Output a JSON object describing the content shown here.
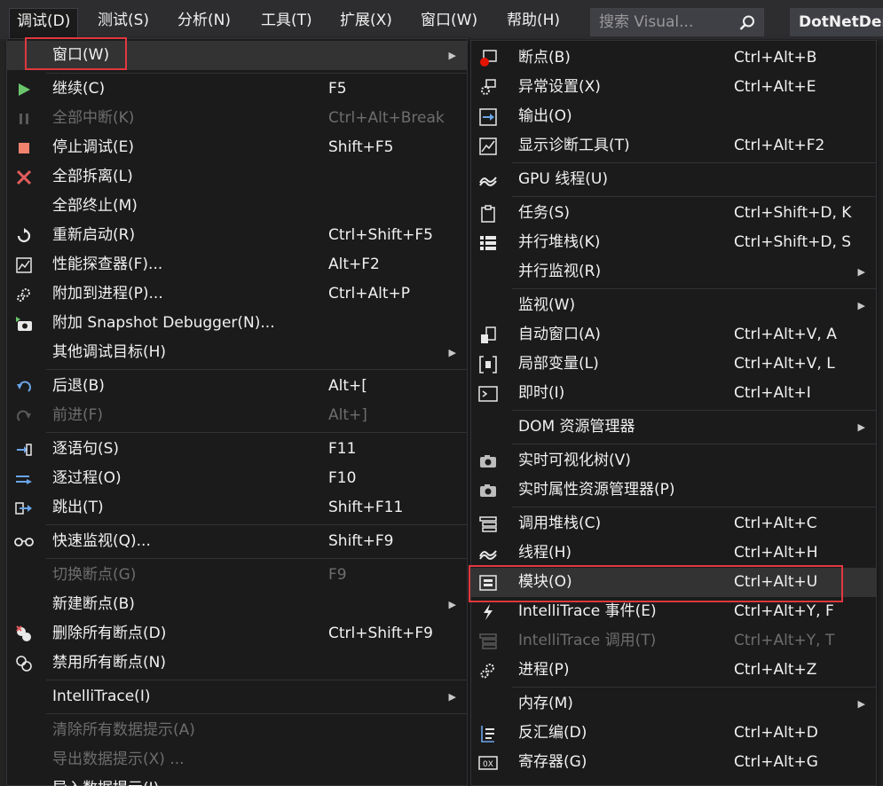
{
  "menubar": {
    "items": [
      {
        "label": "调试(D)"
      },
      {
        "label": "测试(S)"
      },
      {
        "label": "分析(N)"
      },
      {
        "label": "工具(T)"
      },
      {
        "label": "扩展(X)"
      },
      {
        "label": "窗口(W)"
      },
      {
        "label": "帮助(H)"
      }
    ],
    "search_placeholder": "搜索 Visual...",
    "solution_name": "DotNetDem"
  },
  "debug_menu": {
    "items": [
      {
        "label": "窗口(W)",
        "shortcut": "",
        "icon": "none"
      },
      {
        "label": "继续(C)",
        "shortcut": "F5",
        "icon": "play-icon"
      },
      {
        "label": "全部中断(K)",
        "shortcut": "Ctrl+Alt+Break",
        "icon": "pause-icon"
      },
      {
        "label": "停止调试(E)",
        "shortcut": "Shift+F5",
        "icon": "stop-icon"
      },
      {
        "label": "全部拆离(L)",
        "shortcut": "",
        "icon": "close-icon"
      },
      {
        "label": "全部终止(M)",
        "shortcut": "",
        "icon": "none"
      },
      {
        "label": "重新启动(R)",
        "shortcut": "Ctrl+Shift+F5",
        "icon": "restart-icon"
      },
      {
        "label": "性能探查器(F)...",
        "shortcut": "Alt+F2",
        "icon": "profiler-icon"
      },
      {
        "label": "附加到进程(P)...",
        "shortcut": "Ctrl+Alt+P",
        "icon": "gears-icon"
      },
      {
        "label": "附加 Snapshot Debugger(N)...",
        "shortcut": "",
        "icon": "camera-icon"
      },
      {
        "label": "其他调试目标(H)",
        "shortcut": "",
        "icon": "none"
      },
      {
        "label": "后退(B)",
        "shortcut": "Alt+[",
        "icon": "undo-icon"
      },
      {
        "label": "前进(F)",
        "shortcut": "Alt+]",
        "icon": "redo-icon"
      },
      {
        "label": "逐语句(S)",
        "shortcut": "F11",
        "icon": "step-into-icon"
      },
      {
        "label": "逐过程(O)",
        "shortcut": "F10",
        "icon": "step-over-icon"
      },
      {
        "label": "跳出(T)",
        "shortcut": "Shift+F11",
        "icon": "step-out-icon"
      },
      {
        "label": "快速监视(Q)...",
        "shortcut": "Shift+F9",
        "icon": "glasses-icon"
      },
      {
        "label": "切换断点(G)",
        "shortcut": "F9",
        "icon": "none"
      },
      {
        "label": "新建断点(B)",
        "shortcut": "",
        "icon": "none"
      },
      {
        "label": "删除所有断点(D)",
        "shortcut": "Ctrl+Shift+F9",
        "icon": "delete-breakpoints-icon"
      },
      {
        "label": "禁用所有断点(N)",
        "shortcut": "",
        "icon": "disable-breakpoints-icon"
      },
      {
        "label": "IntelliTrace(I)",
        "shortcut": "",
        "icon": "none"
      },
      {
        "label": "清除所有数据提示(A)",
        "shortcut": "",
        "icon": "none"
      },
      {
        "label": "导出数据提示(X) ...",
        "shortcut": "",
        "icon": "none"
      },
      {
        "label": "导入数据提示(I)...",
        "shortcut": "",
        "icon": "none"
      }
    ]
  },
  "window_submenu": {
    "items": [
      {
        "label": "断点(B)",
        "shortcut": "Ctrl+Alt+B",
        "icon": "breakpoint-window-icon"
      },
      {
        "label": "异常设置(X)",
        "shortcut": "Ctrl+Alt+E",
        "icon": "exception-settings-icon"
      },
      {
        "label": "输出(O)",
        "shortcut": "",
        "icon": "output-icon"
      },
      {
        "label": "显示诊断工具(T)",
        "shortcut": "Ctrl+Alt+F2",
        "icon": "diagnostics-icon"
      },
      {
        "label": "GPU 线程(U)",
        "shortcut": "",
        "icon": "gpu-threads-icon"
      },
      {
        "label": "任务(S)",
        "shortcut": "Ctrl+Shift+D, K",
        "icon": "tasks-icon"
      },
      {
        "label": "并行堆栈(K)",
        "shortcut": "Ctrl+Shift+D, S",
        "icon": "parallel-stacks-icon"
      },
      {
        "label": "并行监视(R)",
        "shortcut": "",
        "icon": "none"
      },
      {
        "label": "监视(W)",
        "shortcut": "",
        "icon": "none"
      },
      {
        "label": "自动窗口(A)",
        "shortcut": "Ctrl+Alt+V, A",
        "icon": "autos-icon"
      },
      {
        "label": "局部变量(L)",
        "shortcut": "Ctrl+Alt+V, L",
        "icon": "locals-icon"
      },
      {
        "label": "即时(I)",
        "shortcut": "Ctrl+Alt+I",
        "icon": "immediate-icon"
      },
      {
        "label": "DOM 资源管理器",
        "shortcut": "",
        "icon": "none"
      },
      {
        "label": "实时可视化树(V)",
        "shortcut": "",
        "icon": "camera-icon"
      },
      {
        "label": "实时属性资源管理器(P)",
        "shortcut": "",
        "icon": "camera-icon"
      },
      {
        "label": "调用堆栈(C)",
        "shortcut": "Ctrl+Alt+C",
        "icon": "call-stack-icon"
      },
      {
        "label": "线程(H)",
        "shortcut": "Ctrl+Alt+H",
        "icon": "threads-icon"
      },
      {
        "label": "模块(O)",
        "shortcut": "Ctrl+Alt+U",
        "icon": "modules-icon"
      },
      {
        "label": "IntelliTrace 事件(E)",
        "shortcut": "Ctrl+Alt+Y, F",
        "icon": "lightning-icon"
      },
      {
        "label": "IntelliTrace 调用(T)",
        "shortcut": "Ctrl+Alt+Y, T",
        "icon": "calls-icon"
      },
      {
        "label": "进程(P)",
        "shortcut": "Ctrl+Alt+Z",
        "icon": "gears-icon"
      },
      {
        "label": "内存(M)",
        "shortcut": "",
        "icon": "none"
      },
      {
        "label": "反汇编(D)",
        "shortcut": "Ctrl+Alt+D",
        "icon": "disassembly-icon"
      },
      {
        "label": "寄存器(G)",
        "shortcut": "Ctrl+Alt+G",
        "icon": "registers-icon"
      }
    ]
  },
  "colors": {
    "accent_highlight": "#e0383e",
    "menu_bg": "#1b1b1c",
    "hover_bg": "#333334",
    "disabled_text": "#6d6d6d"
  }
}
